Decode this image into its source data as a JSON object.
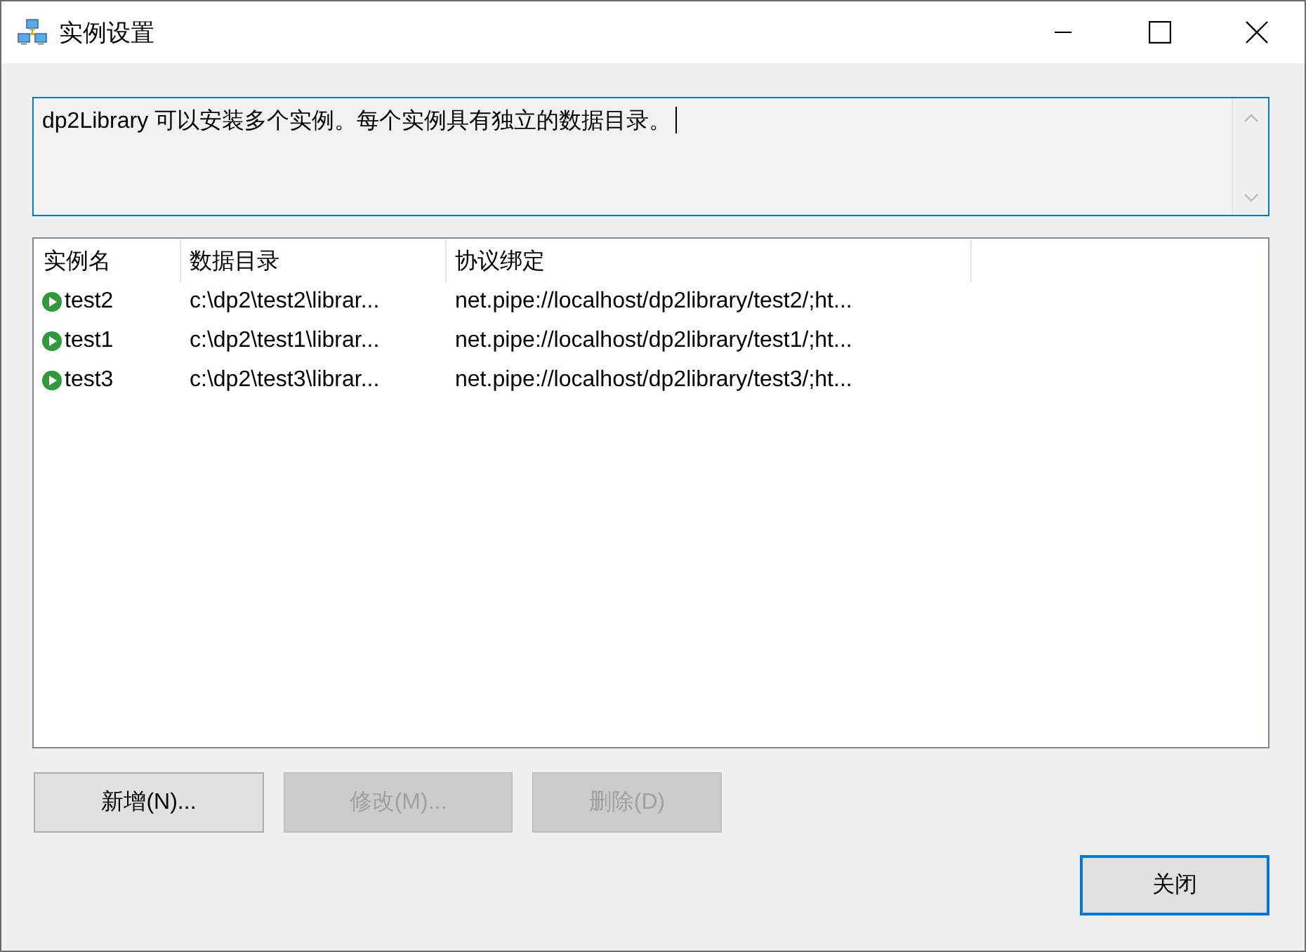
{
  "window": {
    "title": "实例设置"
  },
  "description": {
    "value": "dp2Library 可以安装多个实例。每个实例具有独立的数据目录。",
    "focused": true
  },
  "instances": {
    "columns": [
      "实例名",
      "数据目录",
      "协议绑定"
    ],
    "rows": [
      {
        "cells": [
          "test2",
          "c:\\dp2\\test2\\librar...",
          "net.pipe://localhost/dp2library/test2/;ht..."
        ]
      },
      {
        "cells": [
          "test1",
          "c:\\dp2\\test1\\librar...",
          "net.pipe://localhost/dp2library/test1/;ht..."
        ]
      },
      {
        "cells": [
          "test3",
          "c:\\dp2\\test3\\librar...",
          "net.pipe://localhost/dp2library/test3/;ht..."
        ]
      }
    ]
  },
  "buttons": [
    {
      "label": "新增(N)...",
      "disabled": false
    },
    {
      "label": "修改(M)...",
      "disabled": true
    },
    {
      "label": "删除(D)",
      "disabled": true
    }
  ],
  "close_button": {
    "label": "关闭",
    "default": true
  }
}
